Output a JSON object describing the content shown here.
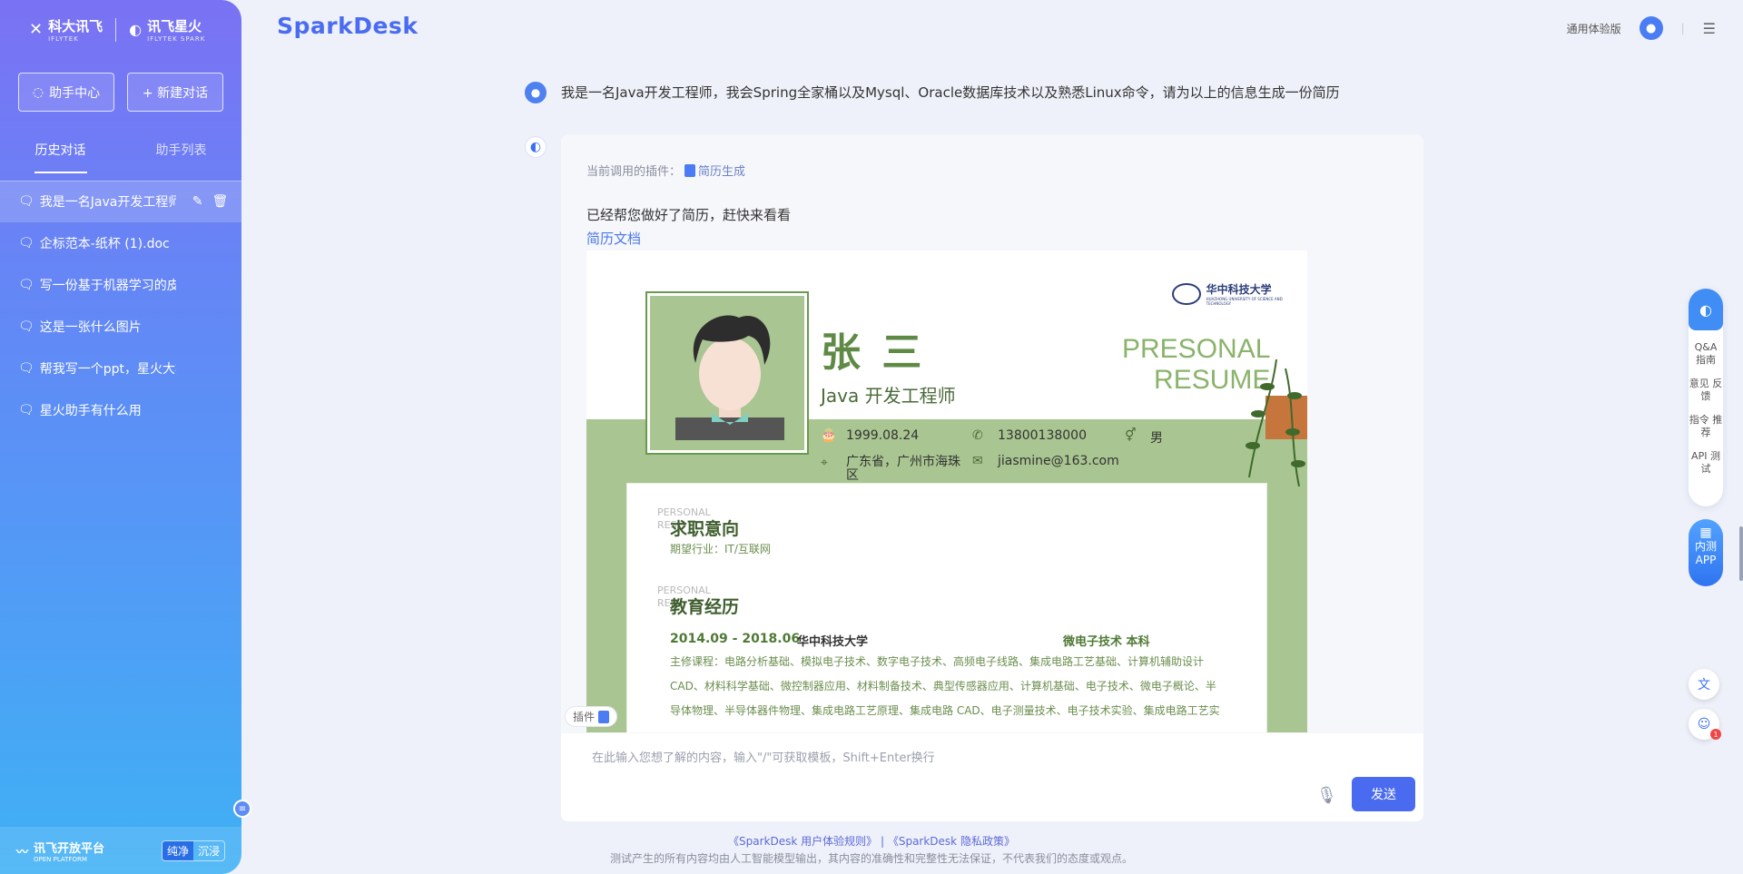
{
  "brand": {
    "iflytek": "科大讯飞",
    "iflytek_en": "IFLYTEK",
    "spark": "讯飞星火",
    "spark_en": "IFLYTEK SPARK"
  },
  "sidebar": {
    "assistant_center": "助手中心",
    "new_chat": "+ 新建对话",
    "tabs": [
      {
        "label": "历史对话"
      },
      {
        "label": "助手列表"
      }
    ],
    "history": [
      {
        "label": "我是一名Java开发工程师"
      },
      {
        "label": "企标范本-纸杯 (1).doc"
      },
      {
        "label": "写一份基于机器学习的皮肤癌检测"
      },
      {
        "label": "这是一张什么图片"
      },
      {
        "label": "帮我写一个ppt，星火大模型V"
      },
      {
        "label": "星火助手有什么用"
      }
    ],
    "open_platform": "讯飞开放平台",
    "open_platform_en": "OPEN PLATFORM",
    "mode_on": "纯净",
    "mode_off": "沉浸"
  },
  "header": {
    "logo": "SparkDesk",
    "version": "通用体验版"
  },
  "chat": {
    "question": "我是一名Java开发工程师，我会Spring全家桶以及Mysql、Oracle数据库技术以及熟悉Linux命令，请为以上的信息生成一份简历",
    "plugin_label": "当前调用的插件：",
    "plugin_name": "简历生成",
    "answer": "已经帮您做好了简历，赶快来看看",
    "doc_link": "简历文档"
  },
  "resume": {
    "school": "华中科技大学",
    "school_en": "HUAZHONG UNIVERSITY OF SCIENCE AND TECHNOLOGY",
    "name": "张 三",
    "title": "Java 开发工程师",
    "presonal": "PRESONAL",
    "resume_word": "RESUME",
    "birth": "1999.08.24",
    "phone": "13800138000",
    "gender": "男",
    "address": "广东省，广州市海珠区",
    "email": "jiasmine@163.com",
    "section_tag": "PERSONAL RES",
    "sec1_title": "求职意向",
    "sec1_text": "期望行业：IT/互联网",
    "sec2_title": "教育经历",
    "edu_period": "2014.09 - 2018.06",
    "edu_school": "华中科技大学",
    "edu_major": "微电子技术  本科",
    "courses": "主修课程：电路分析基础、模拟电子技术、数字电子技术、高频电子线路、集成电路工艺基础、计算机辅助设计CAD、材料科学基础、微控制器应用、材料制备技术、典型传感器应用、计算机基础、电子技术、微电子概论、半导体物理、半导体器件物理、集成电路工艺原理、集成电路 CAD、电子测量技术、电子技术实验、集成电路工艺实"
  },
  "input": {
    "plugin_chip": "插件",
    "placeholder": "在此输入您想了解的内容，输入\"/\"可获取模板，Shift+Enter换行",
    "send": "发送"
  },
  "footer": {
    "links": "《SparkDesk 用户体验规则》  |  《SparkDesk 隐私政策》",
    "disclaimer": "测试产生的所有内容均由人工智能模型输出，其内容的准确性和完整性无法保证，不代表我们的态度或观点。"
  },
  "rail": {
    "qa": "Q&A 指南",
    "feedback": "意见 反馈",
    "cmd": "指令 推荐",
    "api": "API 测试",
    "app": "内测 APP",
    "badge": "1"
  }
}
